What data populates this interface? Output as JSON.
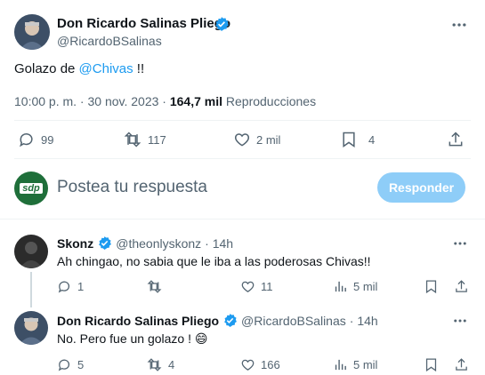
{
  "main_tweet": {
    "author_name": "Don Ricardo Salinas Pliego",
    "handle": "@RicardoBSalinas",
    "text_prefix": "Golazo de ",
    "mention": "@Chivas",
    "text_suffix": " !!",
    "time": "10:00 p. m. · 30 nov. 2023 · ",
    "views_count": "164,7 mil",
    "views_label": "Reproducciones",
    "replies": "99",
    "retweets": "117",
    "likes": "2 mil",
    "bookmarks": "4"
  },
  "compose": {
    "placeholder": "Postea tu respuesta",
    "button_label": "Responder",
    "avatar_text": "sdp"
  },
  "replies": [
    {
      "author_name": "Skonz",
      "handle": "@theonlyskonz",
      "time": "· 14h",
      "text": "Ah chingao, no sabia que le iba a las poderosas Chivas!!",
      "replies": "1",
      "retweets": "",
      "likes": "11",
      "views": "5 mil"
    },
    {
      "author_name": "Don Ricardo Salinas Pliego",
      "handle": "@RicardoBSalinas",
      "time": "· 14h",
      "text": "No. Pero fue un golazo ! 😄",
      "replies": "5",
      "retweets": "4",
      "likes": "166",
      "views": "5 mil"
    }
  ],
  "colors": {
    "accent": "#1d9bf0",
    "muted": "#536471",
    "disabled_button": "#8ecdf8",
    "sdp_green": "#1f6f3a"
  }
}
